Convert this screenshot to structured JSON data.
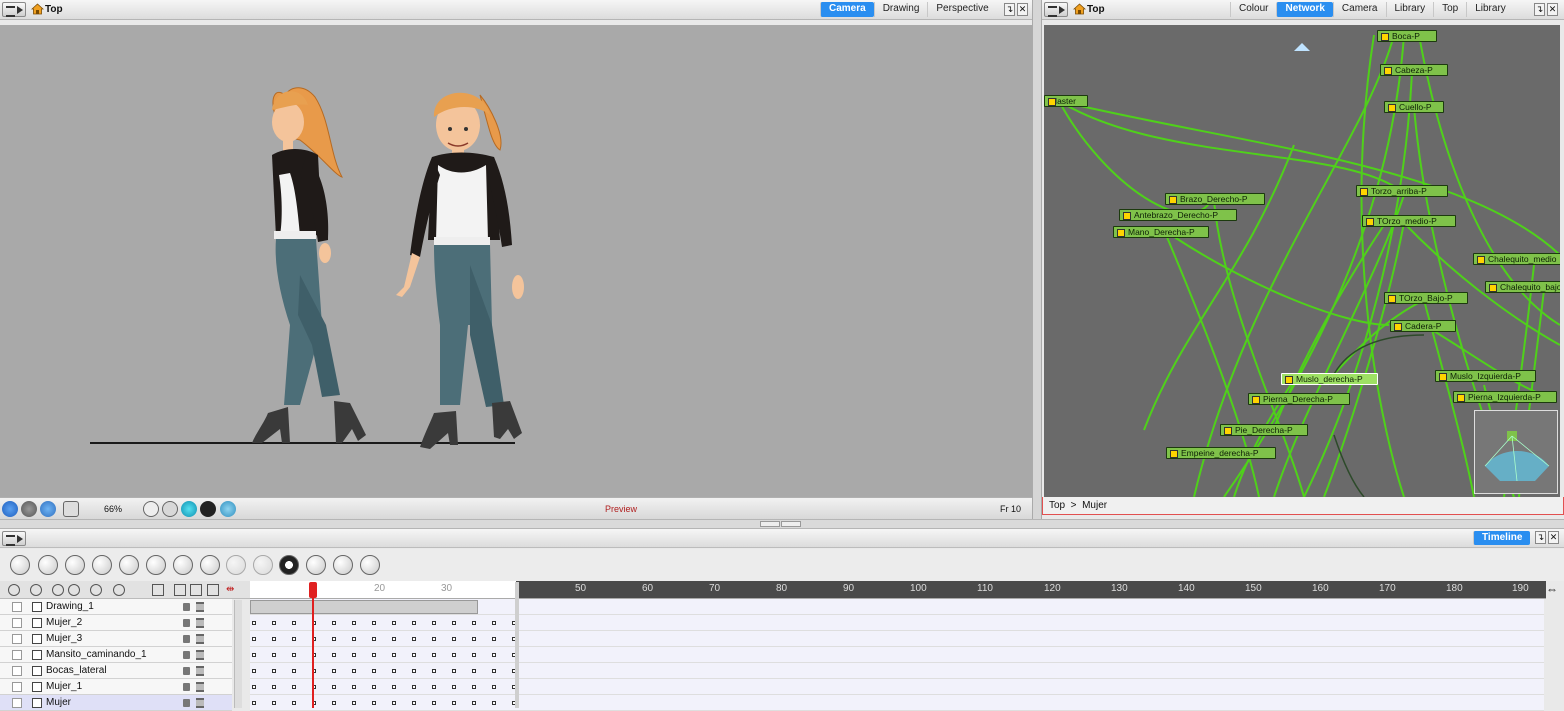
{
  "camera_panel": {
    "breadcrumb": "Top",
    "tabs": [
      {
        "label": "Camera",
        "active": true
      },
      {
        "label": "Drawing",
        "active": false
      },
      {
        "label": "Perspective",
        "active": false
      }
    ],
    "zoom": "66%",
    "status": "Preview",
    "frame": "Fr 10"
  },
  "network_panel": {
    "breadcrumb": "Top",
    "tabs": [
      {
        "label": "Colour",
        "active": false
      },
      {
        "label": "Network",
        "active": true
      },
      {
        "label": "Camera",
        "active": false
      },
      {
        "label": "Library",
        "active": false
      },
      {
        "label": "Top",
        "active": false
      },
      {
        "label": "Library",
        "active": false
      }
    ],
    "path": "Top  >  Mujer",
    "nodes": [
      "Boca-P",
      "Cabeza-P",
      "Cuello-P",
      "Master",
      "Torzo_arriba-P",
      "Brazo_Derecho-P",
      "Antebrazo_Derecho-P",
      "TOrzo_medio-P",
      "Mano_Derecha-P",
      "Chalequito_medio",
      "Chalequito_bajo",
      "TOrzo_Bajo-P",
      "Cadera-P",
      "Muslo_derecha-P",
      "Muslo_Izquierda-P",
      "Pierna_Derecha-P",
      "Pierna_Izquierda-P",
      "Pie_Derecha-P",
      "Empeine_derecha-P"
    ]
  },
  "timeline": {
    "tab": "Timeline",
    "ruler": [
      "20",
      "30",
      "50",
      "60",
      "70",
      "80",
      "90",
      "100",
      "110",
      "120",
      "130",
      "140",
      "150",
      "160",
      "170",
      "180",
      "190"
    ],
    "current_frame": 10,
    "layers": [
      {
        "name": "Drawing_1",
        "selected": false
      },
      {
        "name": "Mujer_2",
        "selected": false
      },
      {
        "name": "Mujer_3",
        "selected": false
      },
      {
        "name": "Mansito_caminando_1",
        "selected": false
      },
      {
        "name": "Bocas_lateral",
        "selected": false
      },
      {
        "name": "Mujer_1",
        "selected": false
      },
      {
        "name": "Mujer",
        "selected": true
      }
    ]
  },
  "colors": {
    "accent": "#2a8ef0",
    "node_green": "#7fc24a",
    "wire_green": "#4fd11a",
    "playhead_red": "#e02020"
  }
}
